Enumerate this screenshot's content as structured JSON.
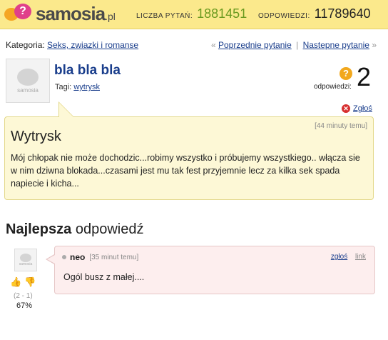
{
  "header": {
    "logo_text": "samosia",
    "logo_tld": ".pl",
    "questions_label": "LICZBA PYTAŃ:",
    "questions_value": "1881451",
    "answers_label": "ODPOWIEDZI:",
    "answers_value": "11789640"
  },
  "category": {
    "label": "Kategoria:",
    "value": "Seks, zwiazki i romanse",
    "prev_arrow": "«",
    "prev": "Poprzednie pytanie",
    "sep": "|",
    "next": "Nastepne pytanie",
    "next_arrow": "»"
  },
  "question": {
    "avatar_label": "samosia",
    "title": "bla bla bla",
    "tags_label": "Tagi:",
    "tag": "wytrysk",
    "answers_label": "odpowiedzi:",
    "answers_count": "2",
    "report": "Zgłoś",
    "time": "[44 minuty temu]",
    "heading": "Wytrysk",
    "body": "Mój chłopak nie może dochodzic...robimy wszystko i próbujemy wszystkiego.. włącza sie w nim dziwna blokada...czasami jest mu tak fest przyjemnie lecz za kilka sek spada napiecie i kicha..."
  },
  "best_answer": {
    "heading_bold": "Najlepsza",
    "heading_rest": " odpowiedź",
    "avatar_label": "samosia",
    "vote_counts": "(2 - 1)",
    "vote_pct": "67%",
    "author": "neo",
    "time": "[35 minut temu]",
    "report": "zgłoś",
    "link": "link",
    "text": "Ogól busz z małej...."
  }
}
